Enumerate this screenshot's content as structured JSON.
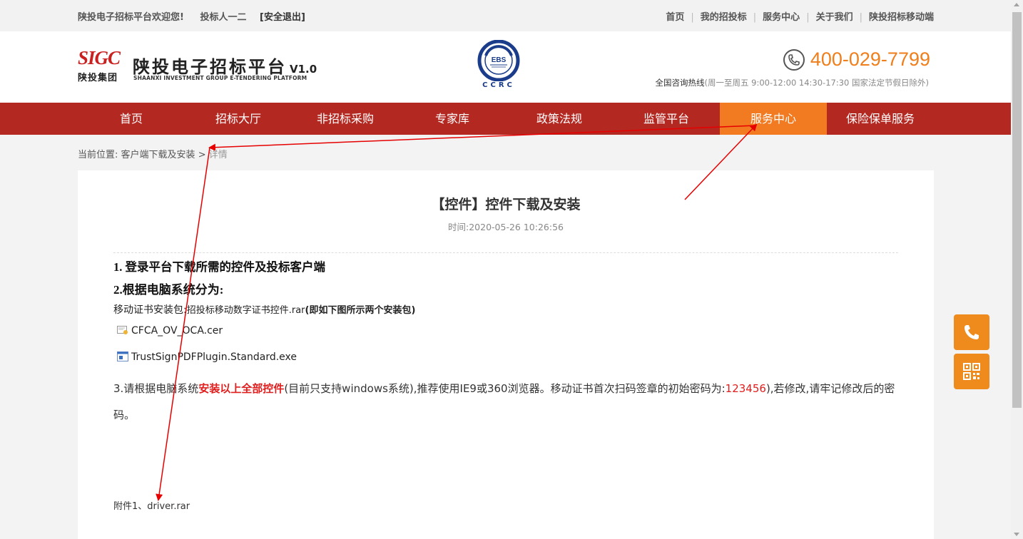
{
  "topbar": {
    "welcome": "陕投电子招标平台欢迎您!",
    "user": "投标人一二",
    "logout": "[安全退出]",
    "links": [
      "首页",
      "我的招投标",
      "服务中心",
      "关于我们",
      "陕投招标移动端"
    ]
  },
  "header": {
    "logo_sigc": "SIGC",
    "logo_group": "陕投集团",
    "title": "陕投电子招标平台",
    "version": "V1.0",
    "subtitle": "SHAANXI INVESTMENT GROUP E-TENDERING PLATFORM",
    "badge_text": "CCRC",
    "badge_inner": "EBS",
    "phone": "400-029-7799",
    "hotline_label": "全国咨询热线",
    "hotline_hours": "(周一至周五 9:00-12:00 14:30-17:30 国家法定节假日除外)"
  },
  "nav": {
    "items": [
      "首页",
      "招标大厅",
      "非招标采购",
      "专家库",
      "政策法规",
      "监管平台",
      "服务中心",
      "保险保单服务"
    ],
    "active": "服务中心"
  },
  "breadcrumb": {
    "label": "当前位置:",
    "parent": "客户端下载及安装",
    "sep": ">",
    "current": "详情"
  },
  "article": {
    "title": "【控件】控件下载及安装",
    "time": "时间:2020-05-26 10:26:56",
    "step1": "1. 登录平台下载所需的控件及投标客户端",
    "step2": "2.根据电脑系统分为:",
    "pkg_label": "移动证书安装包:",
    "pkg_file": "招投标移动数字证书控件.rar",
    "pkg_note": "(即如下图所示两个安装包)",
    "file1": "CFCA_OV_OCA.cer",
    "file2": "TrustSignPDFPlugin.Standard.exe",
    "step3_a": "3.请根据电脑系统",
    "step3_b": "安装以上全部控件",
    "step3_c": "(目前只支持windows系统),推荐使用IE9或360浏览器。移动证书首次扫码签章的初始密码为:",
    "step3_pwd": "123456",
    "step3_d": "),若修改,请牢记修改后的密码。",
    "attachment": "附件1、driver.rar"
  },
  "side": {
    "buttons": [
      "phone-icon",
      "qrcode-icon"
    ]
  },
  "colors": {
    "nav_bg": "#b42822",
    "nav_active": "#f27a21",
    "phone": "#ef7e1b",
    "side_btn": "#ef8a1d",
    "annotation": "#e60000"
  }
}
